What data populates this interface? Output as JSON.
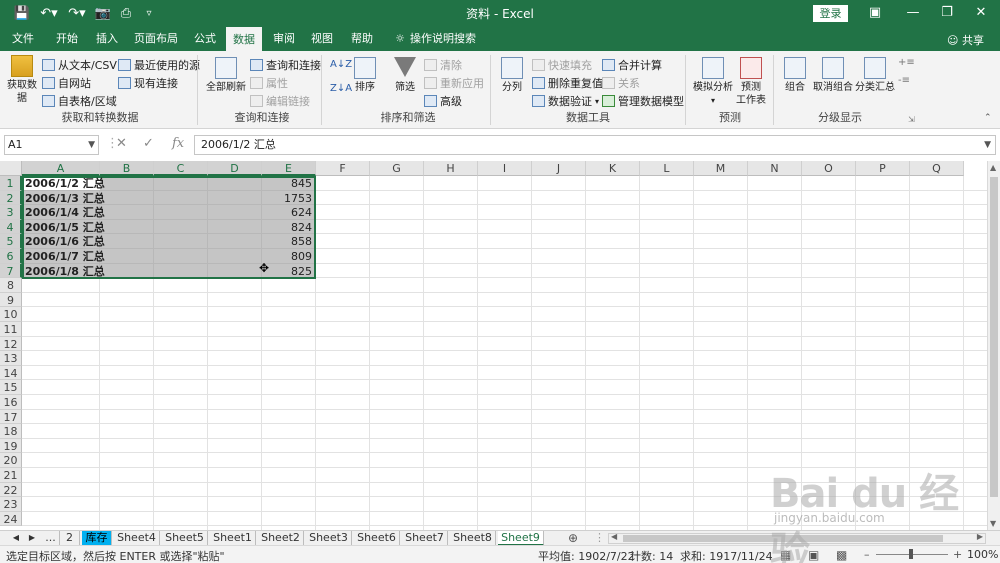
{
  "window": {
    "title": "资料 - Excel",
    "login": "登录",
    "share": "共享"
  },
  "tabs": [
    "文件",
    "开始",
    "插入",
    "页面布局",
    "公式",
    "数据",
    "审阅",
    "视图",
    "帮助",
    "操作说明搜索"
  ],
  "active_tab": "数据",
  "ribbon": {
    "get_data": {
      "label": "获取数据",
      "label2": "据",
      "group": "获取和转换数据"
    },
    "from_text": "从文本/CSV",
    "from_web": "自网站",
    "from_table": "自表格/区域",
    "recent_sources": "最近使用的源",
    "existing_conn": "现有连接",
    "refresh_all": "全部刷新",
    "query_conn": "查询和连接",
    "properties": "属性",
    "edit_links": "编辑链接",
    "query_group": "查询和连接",
    "sort": "排序",
    "filter": "筛选",
    "clear": "清除",
    "reapply": "重新应用",
    "advanced": "高级",
    "sort_group": "排序和筛选",
    "split": "分列",
    "flash_fill": "快速填充",
    "remove_dup": "删除重复值",
    "validation": "数据验证",
    "consolidate": "合并计算",
    "relations": "关系",
    "data_model": "管理数据模型",
    "tools_group": "数据工具",
    "whatif": "模拟分析",
    "forecast": "预测",
    "forecast2": "工作表",
    "forecast_group": "预测",
    "group": "组合",
    "ungroup": "取消组合",
    "subtotal": "分类汇总",
    "outline_group": "分级显示"
  },
  "formula_bar": {
    "name_box": "A1",
    "content": "2006/1/2 汇总"
  },
  "columns": [
    "A",
    "B",
    "C",
    "D",
    "E",
    "F",
    "G",
    "H",
    "I",
    "J",
    "K",
    "L",
    "M",
    "N",
    "O",
    "P",
    "Q"
  ],
  "rows": [
    "1",
    "2",
    "3",
    "4",
    "5",
    "6",
    "7",
    "8",
    "9",
    "10",
    "11",
    "12",
    "13",
    "14",
    "15",
    "16",
    "17",
    "18",
    "19",
    "20",
    "21",
    "22",
    "23",
    "24"
  ],
  "cells": [
    {
      "a": "2006/1/2 汇总",
      "e": "845"
    },
    {
      "a": "2006/1/3 汇总",
      "e": "1753"
    },
    {
      "a": "2006/1/4 汇总",
      "e": "624"
    },
    {
      "a": "2006/1/5 汇总",
      "e": "824"
    },
    {
      "a": "2006/1/6 汇总",
      "e": "858"
    },
    {
      "a": "2006/1/7 汇总",
      "e": "809"
    },
    {
      "a": "2006/1/8 汇总",
      "e": "825"
    }
  ],
  "sheet_tabs": {
    "ellipsis": "...",
    "tabs": [
      "2",
      "库存",
      "Sheet4",
      "Sheet5",
      "Sheet1",
      "Sheet2",
      "Sheet3",
      "Sheet6",
      "Sheet7",
      "Sheet8",
      "Sheet9"
    ],
    "active": "Sheet9",
    "colored": "库存",
    "colored_color": "#00b0f0"
  },
  "status": {
    "message": "选定目标区域，然后按 ENTER 或选择\"粘贴\"",
    "average": "平均值: 1902/7/22",
    "count": "计数: 14",
    "sum": "求和: 1917/11/24",
    "zoom": "100%"
  },
  "colors": {
    "accent": "#217346",
    "selection": "#969696"
  },
  "watermark": {
    "text": "Bai du 经验",
    "url": "jingyan.baidu.com"
  }
}
